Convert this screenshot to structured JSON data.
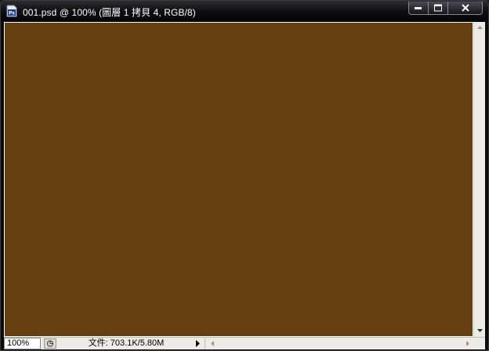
{
  "window": {
    "title": "001.psd @ 100% (圖層 1 拷貝 4, RGB/8)",
    "app_icon": "photoshop-icon"
  },
  "canvas": {
    "fill_color": "#653f10"
  },
  "status": {
    "zoom": "100%",
    "doc_info": "文件: 703.1K/5.80M"
  },
  "colors": {
    "titlebar": "#0d0d10",
    "canvas": "#653f10",
    "chrome": "#ecebe6"
  }
}
